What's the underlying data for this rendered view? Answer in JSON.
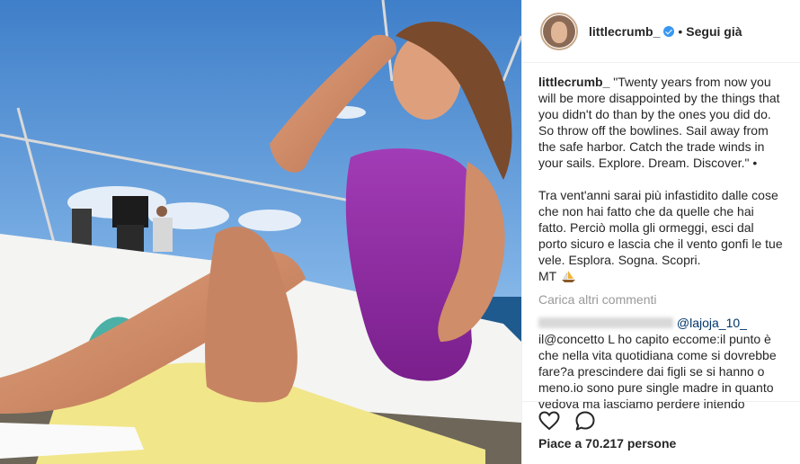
{
  "header": {
    "username": "littlecrumb_",
    "follow_label": "Segui già",
    "separator": "•"
  },
  "caption": {
    "username": "littlecrumb_",
    "text_en": "\"Twenty years from now you will be more disappointed by the things that you didn't do than by the ones you did do. So throw off the bowlines. Sail away from the safe harbor. Catch the trade winds in your sails. Explore. Dream. Discover.\" •",
    "text_it": "Tra vent'anni sarai più infastidito dalle cose che non hai fatto che da quelle che hai fatto. Perciò molla gli ormeggi, esci dal porto sicuro e lascia che il vento gonfi le tue vele. Esplora. Sogna. Scopri.",
    "signature": "MT"
  },
  "load_more": "Carica altri commenti",
  "comment": {
    "mention": "@lajoja_10_",
    "text": "il@concetto L ho capito eccome:il punto è che nella vita quotidiana come si dovrebbe fare?a prescindere dai figli se si hanno o meno.io sono pure single madre in quanto vedova ma lasciamo perdere intendo"
  },
  "likes": "Piace a 70.217 persone",
  "icons": {
    "like": "heart-icon",
    "comment": "speech-bubble-icon",
    "verified": "verified-badge-icon",
    "emoji": "sailboat-icon"
  },
  "colors": {
    "accent_blue": "#3897f0",
    "mention_blue": "#003569",
    "muted": "#999999",
    "swimsuit": "#8e2a9e"
  }
}
